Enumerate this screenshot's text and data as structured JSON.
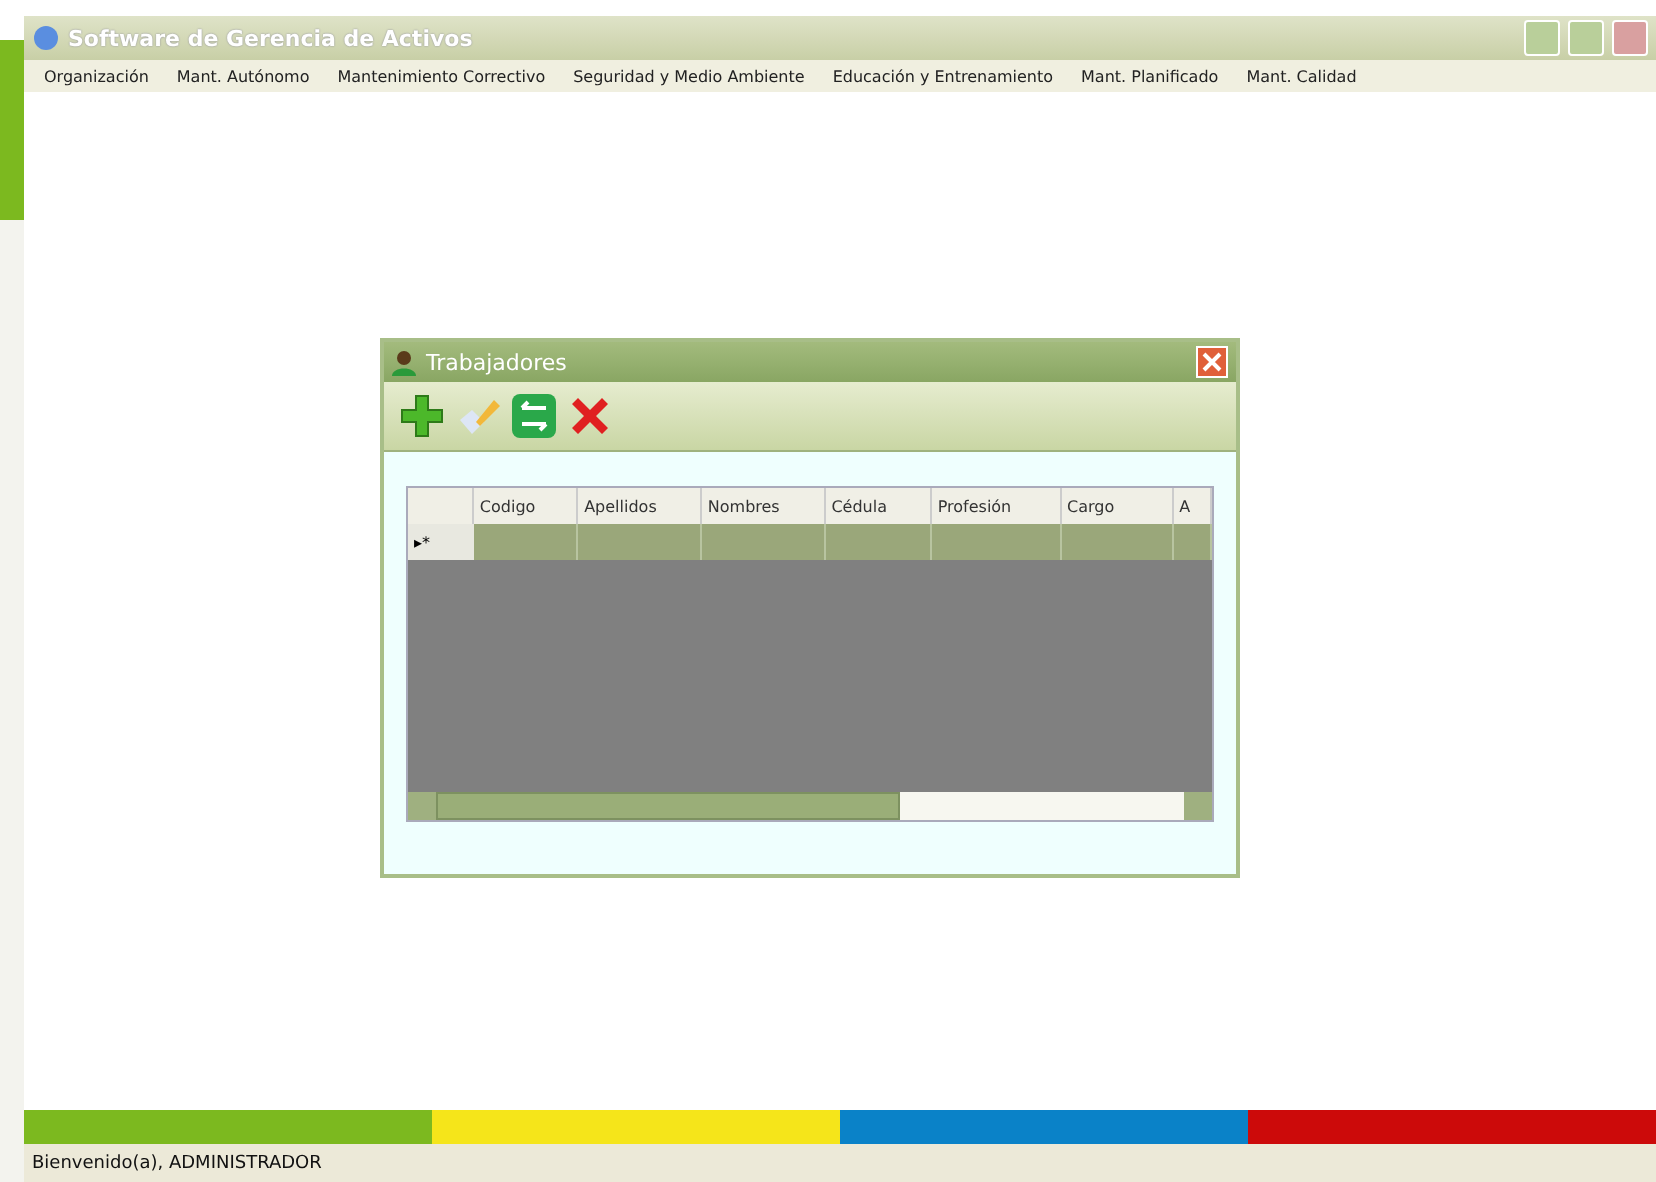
{
  "window": {
    "title": "Software de Gerencia de Activos"
  },
  "menu": [
    "Organización",
    "Mant. Autónomo",
    "Mantenimiento Correctivo",
    "Seguridad y Medio Ambiente",
    "Educación y Entrenamiento",
    "Mant. Planificado",
    "Mant. Calidad"
  ],
  "dialog": {
    "title": "Trabajadores",
    "toolbar": [
      {
        "kind": "add"
      },
      {
        "kind": "edit"
      },
      {
        "kind": "refresh"
      },
      {
        "kind": "delete"
      }
    ],
    "table": {
      "columns": [
        "Codigo",
        "Apellidos",
        "Nombres",
        "Cédula",
        "Profesión",
        "Cargo",
        "A"
      ],
      "new_row_marker": "▸*"
    }
  },
  "stripe": [
    {
      "color": "#7cb91f"
    },
    {
      "color": "#f5e51a"
    },
    {
      "color": "#0a82c8"
    },
    {
      "color": "#cc0a0a"
    }
  ],
  "status_bar": "Bienvenido(a), ADMINISTRADOR"
}
